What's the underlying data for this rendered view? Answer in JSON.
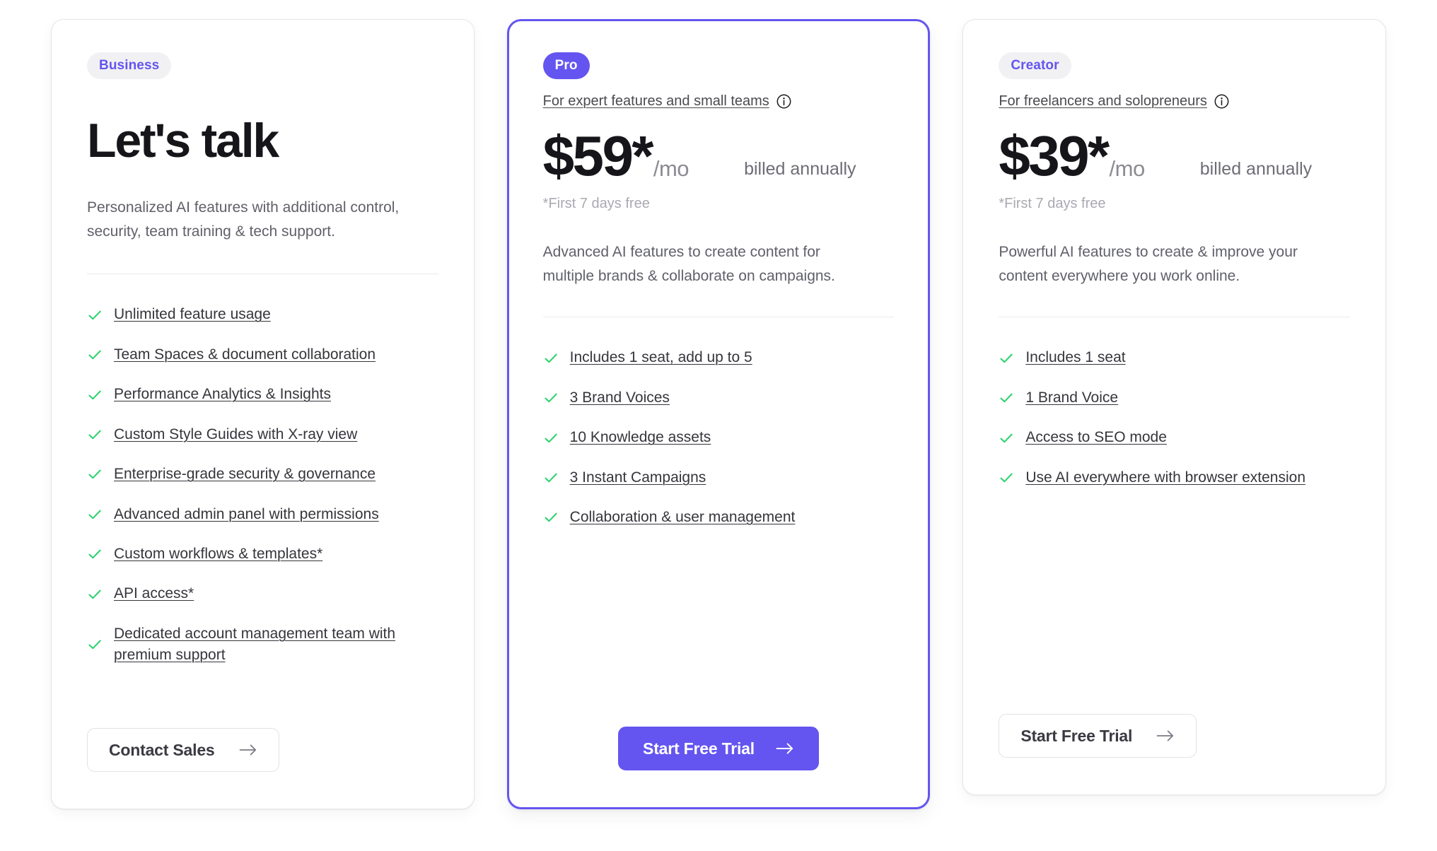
{
  "plans": [
    {
      "badge": "Business",
      "headline": "Let's talk",
      "description": "Personalized AI features with additional control, security, team training & tech support.",
      "features": [
        "Unlimited feature usage",
        "Team Spaces & document collaboration",
        "Performance Analytics & Insights",
        "Custom Style Guides with X-ray view",
        "Enterprise-grade security & governance",
        "Advanced admin panel with permissions",
        "Custom workflows & templates*",
        "API access*",
        "Dedicated account management team with premium support"
      ],
      "cta_label": "Contact Sales"
    },
    {
      "badge": "Pro",
      "tagline": "For expert features and small teams",
      "price_amount": "$59*",
      "price_period": "/mo",
      "price_billing": "billed annually",
      "price_note": "*First 7 days free",
      "description": "Advanced AI features to create content for multiple brands & collaborate on campaigns.",
      "features": [
        "Includes 1 seat, add up to 5",
        "3 Brand Voices",
        "10 Knowledge assets",
        "3 Instant Campaigns",
        "Collaboration & user management"
      ],
      "cta_label": "Start Free Trial"
    },
    {
      "badge": "Creator",
      "tagline": "For freelancers and solopreneurs",
      "price_amount": "$39*",
      "price_period": "/mo",
      "price_billing": "billed annually",
      "price_note": "*First 7 days free",
      "description": "Powerful AI features to create & improve your content everywhere you work online.",
      "features": [
        "Includes 1 seat",
        "1 Brand Voice",
        "Access to SEO mode",
        "Use AI everywhere with browser extension"
      ],
      "cta_label": "Start Free Trial"
    }
  ],
  "icons": {
    "check": "check-icon",
    "info": "info-icon",
    "arrow": "arrow-right-icon"
  },
  "colors": {
    "accent": "#6455f0",
    "badge_bg": "#f1f1f3",
    "check_green": "#2fd36f",
    "text_primary": "#16161a",
    "text_muted": "#6d6d75",
    "text_faint": "#a9a9b1",
    "card_border": "#e6e6e8"
  }
}
